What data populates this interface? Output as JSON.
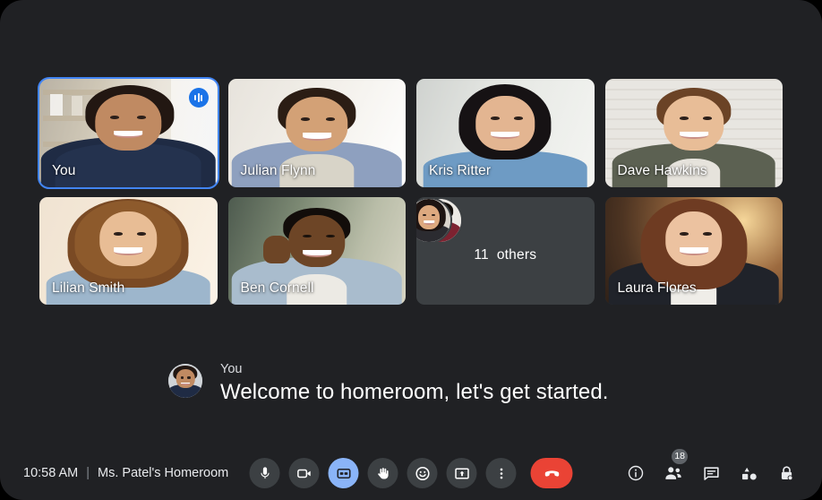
{
  "meeting": {
    "time": "10:58 AM",
    "separator": "|",
    "name": "Ms. Patel's Homeroom"
  },
  "grid": {
    "tiles": [
      {
        "name": "You",
        "speaking": true,
        "badge_icon": "audio-level-icon"
      },
      {
        "name": "Julian Flynn",
        "speaking": false
      },
      {
        "name": "Kris Ritter",
        "speaking": false
      },
      {
        "name": "Dave Hawkins",
        "speaking": false
      },
      {
        "name": "Lilian Smith",
        "speaking": false
      },
      {
        "name": "Ben Cornell",
        "speaking": false
      },
      {
        "name": "Laura Flores",
        "speaking": false
      }
    ],
    "overflow": {
      "count": "11",
      "label": "others",
      "avatar_count": 2
    }
  },
  "caption": {
    "speaker": "You",
    "text": "Welcome to homeroom, let's get started.",
    "avatar_name": "caption-avatar"
  },
  "controls": [
    {
      "id": "microphone",
      "label": "Microphone",
      "icon": "microphone-icon",
      "active": false
    },
    {
      "id": "camera",
      "label": "Camera",
      "icon": "camera-icon",
      "active": false
    },
    {
      "id": "captions",
      "label": "CC",
      "icon": "closed-captions-icon",
      "active": true
    },
    {
      "id": "raise-hand",
      "label": "Raise hand",
      "icon": "raise-hand-icon",
      "active": false
    },
    {
      "id": "reactions",
      "label": "Reactions",
      "icon": "emoji-smiley-icon",
      "active": false
    },
    {
      "id": "present",
      "label": "Present now",
      "icon": "present-screen-icon",
      "active": false
    },
    {
      "id": "more-options",
      "label": "More options",
      "icon": "more-vertical-icon",
      "active": false
    },
    {
      "id": "end-call",
      "label": "Leave call",
      "icon": "end-call-icon",
      "active": false
    }
  ],
  "right_controls": [
    {
      "id": "meeting-details",
      "label": "Meeting details",
      "icon": "info-icon",
      "badge": null
    },
    {
      "id": "people",
      "label": "People",
      "icon": "people-icon",
      "badge": "18"
    },
    {
      "id": "chat",
      "label": "Chat",
      "icon": "chat-bubble-icon",
      "badge": null
    },
    {
      "id": "activities",
      "label": "Activities",
      "icon": "activities-shapes-icon",
      "badge": null
    },
    {
      "id": "host-controls",
      "label": "Host controls",
      "icon": "lock-icon",
      "badge": null
    }
  ],
  "colors": {
    "background": "#202124",
    "tile_placeholder": "#3c4043",
    "speaking_border": "#4285f4",
    "speaking_badge": "#1a73e8",
    "accent_active": "#8ab4f8",
    "end_call": "#ea4335",
    "text_primary": "#ffffff",
    "text_secondary": "#dadce0",
    "badge_bg": "#5f6368"
  }
}
